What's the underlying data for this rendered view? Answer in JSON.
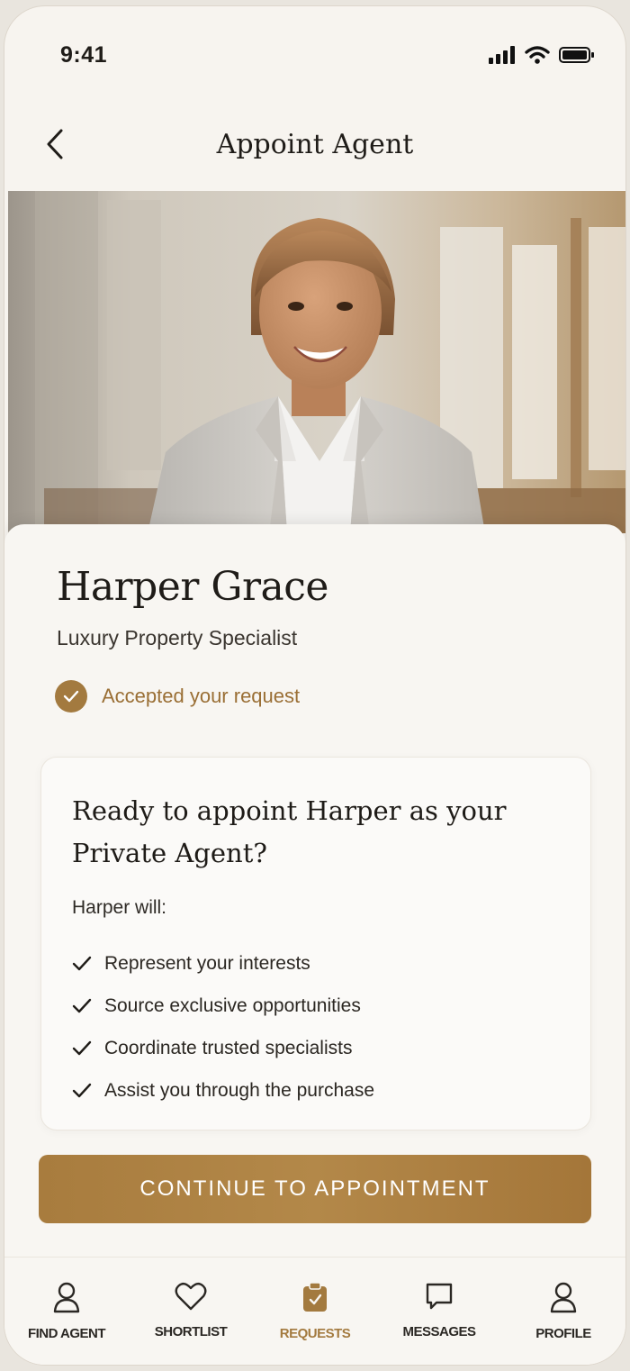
{
  "status_bar": {
    "time": "9:41"
  },
  "header": {
    "title": "Appoint Agent"
  },
  "agent": {
    "name": "Harper Grace",
    "role": "Luxury Property Specialist",
    "status": "Accepted your request"
  },
  "appointment_card": {
    "question": "Ready to appoint Harper as your Private Agent?",
    "intro": "Harper will:",
    "items": [
      "Represent your interests",
      "Source exclusive opportunities",
      "Coordinate trusted specialists",
      "Assist you through the purchase"
    ]
  },
  "cta": {
    "label": "CONTINUE TO APPOINTMENT"
  },
  "nav": {
    "items": [
      {
        "label": "FIND AGENT",
        "icon": "person-icon",
        "active": false
      },
      {
        "label": "SHORTLIST",
        "icon": "heart-icon",
        "active": false
      },
      {
        "label": "REQUESTS",
        "icon": "clipboard-icon",
        "active": true
      },
      {
        "label": "MESSAGES",
        "icon": "chat-bubble-icon",
        "active": false
      },
      {
        "label": "PROFILE",
        "icon": "profile-icon",
        "active": false
      }
    ]
  },
  "colors": {
    "accent": "#a37a3f",
    "background": "#f7f4ef",
    "text": "#1f1c18"
  }
}
